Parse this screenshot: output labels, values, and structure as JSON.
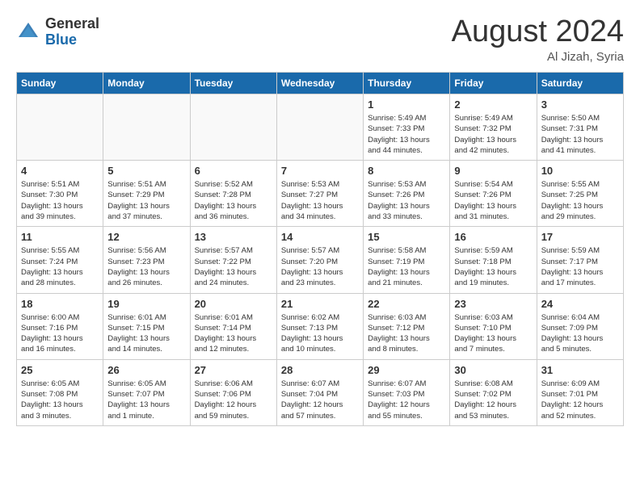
{
  "header": {
    "logo_general": "General",
    "logo_blue": "Blue",
    "month_year": "August 2024",
    "location": "Al Jizah, Syria"
  },
  "days_of_week": [
    "Sunday",
    "Monday",
    "Tuesday",
    "Wednesday",
    "Thursday",
    "Friday",
    "Saturday"
  ],
  "weeks": [
    [
      {
        "day": "",
        "info": ""
      },
      {
        "day": "",
        "info": ""
      },
      {
        "day": "",
        "info": ""
      },
      {
        "day": "",
        "info": ""
      },
      {
        "day": "1",
        "info": "Sunrise: 5:49 AM\nSunset: 7:33 PM\nDaylight: 13 hours\nand 44 minutes."
      },
      {
        "day": "2",
        "info": "Sunrise: 5:49 AM\nSunset: 7:32 PM\nDaylight: 13 hours\nand 42 minutes."
      },
      {
        "day": "3",
        "info": "Sunrise: 5:50 AM\nSunset: 7:31 PM\nDaylight: 13 hours\nand 41 minutes."
      }
    ],
    [
      {
        "day": "4",
        "info": "Sunrise: 5:51 AM\nSunset: 7:30 PM\nDaylight: 13 hours\nand 39 minutes."
      },
      {
        "day": "5",
        "info": "Sunrise: 5:51 AM\nSunset: 7:29 PM\nDaylight: 13 hours\nand 37 minutes."
      },
      {
        "day": "6",
        "info": "Sunrise: 5:52 AM\nSunset: 7:28 PM\nDaylight: 13 hours\nand 36 minutes."
      },
      {
        "day": "7",
        "info": "Sunrise: 5:53 AM\nSunset: 7:27 PM\nDaylight: 13 hours\nand 34 minutes."
      },
      {
        "day": "8",
        "info": "Sunrise: 5:53 AM\nSunset: 7:26 PM\nDaylight: 13 hours\nand 33 minutes."
      },
      {
        "day": "9",
        "info": "Sunrise: 5:54 AM\nSunset: 7:26 PM\nDaylight: 13 hours\nand 31 minutes."
      },
      {
        "day": "10",
        "info": "Sunrise: 5:55 AM\nSunset: 7:25 PM\nDaylight: 13 hours\nand 29 minutes."
      }
    ],
    [
      {
        "day": "11",
        "info": "Sunrise: 5:55 AM\nSunset: 7:24 PM\nDaylight: 13 hours\nand 28 minutes."
      },
      {
        "day": "12",
        "info": "Sunrise: 5:56 AM\nSunset: 7:23 PM\nDaylight: 13 hours\nand 26 minutes."
      },
      {
        "day": "13",
        "info": "Sunrise: 5:57 AM\nSunset: 7:22 PM\nDaylight: 13 hours\nand 24 minutes."
      },
      {
        "day": "14",
        "info": "Sunrise: 5:57 AM\nSunset: 7:20 PM\nDaylight: 13 hours\nand 23 minutes."
      },
      {
        "day": "15",
        "info": "Sunrise: 5:58 AM\nSunset: 7:19 PM\nDaylight: 13 hours\nand 21 minutes."
      },
      {
        "day": "16",
        "info": "Sunrise: 5:59 AM\nSunset: 7:18 PM\nDaylight: 13 hours\nand 19 minutes."
      },
      {
        "day": "17",
        "info": "Sunrise: 5:59 AM\nSunset: 7:17 PM\nDaylight: 13 hours\nand 17 minutes."
      }
    ],
    [
      {
        "day": "18",
        "info": "Sunrise: 6:00 AM\nSunset: 7:16 PM\nDaylight: 13 hours\nand 16 minutes."
      },
      {
        "day": "19",
        "info": "Sunrise: 6:01 AM\nSunset: 7:15 PM\nDaylight: 13 hours\nand 14 minutes."
      },
      {
        "day": "20",
        "info": "Sunrise: 6:01 AM\nSunset: 7:14 PM\nDaylight: 13 hours\nand 12 minutes."
      },
      {
        "day": "21",
        "info": "Sunrise: 6:02 AM\nSunset: 7:13 PM\nDaylight: 13 hours\nand 10 minutes."
      },
      {
        "day": "22",
        "info": "Sunrise: 6:03 AM\nSunset: 7:12 PM\nDaylight: 13 hours\nand 8 minutes."
      },
      {
        "day": "23",
        "info": "Sunrise: 6:03 AM\nSunset: 7:10 PM\nDaylight: 13 hours\nand 7 minutes."
      },
      {
        "day": "24",
        "info": "Sunrise: 6:04 AM\nSunset: 7:09 PM\nDaylight: 13 hours\nand 5 minutes."
      }
    ],
    [
      {
        "day": "25",
        "info": "Sunrise: 6:05 AM\nSunset: 7:08 PM\nDaylight: 13 hours\nand 3 minutes."
      },
      {
        "day": "26",
        "info": "Sunrise: 6:05 AM\nSunset: 7:07 PM\nDaylight: 13 hours\nand 1 minute."
      },
      {
        "day": "27",
        "info": "Sunrise: 6:06 AM\nSunset: 7:06 PM\nDaylight: 12 hours\nand 59 minutes."
      },
      {
        "day": "28",
        "info": "Sunrise: 6:07 AM\nSunset: 7:04 PM\nDaylight: 12 hours\nand 57 minutes."
      },
      {
        "day": "29",
        "info": "Sunrise: 6:07 AM\nSunset: 7:03 PM\nDaylight: 12 hours\nand 55 minutes."
      },
      {
        "day": "30",
        "info": "Sunrise: 6:08 AM\nSunset: 7:02 PM\nDaylight: 12 hours\nand 53 minutes."
      },
      {
        "day": "31",
        "info": "Sunrise: 6:09 AM\nSunset: 7:01 PM\nDaylight: 12 hours\nand 52 minutes."
      }
    ]
  ]
}
